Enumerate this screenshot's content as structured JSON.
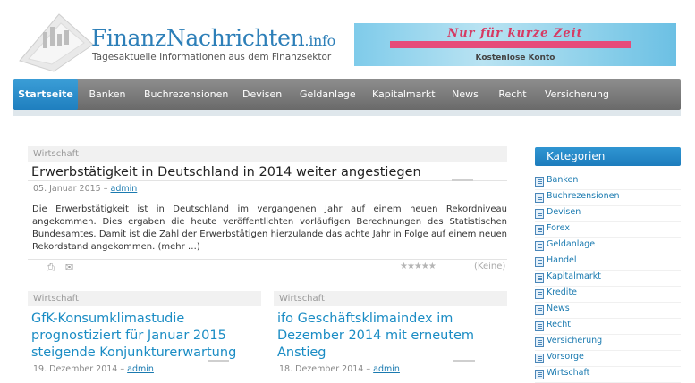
{
  "header": {
    "logo_title_main": "FinanzNachrichten",
    "logo_title_tld": ".info",
    "tagline": "Tagesaktuelle Informationen aus dem Finanzsektor",
    "banner_text": "Nur für kurze Zeit",
    "banner_sub": "Kostenlose Konto"
  },
  "nav": {
    "items": [
      {
        "label": "Startseite",
        "active": true
      },
      {
        "label": "Banken"
      },
      {
        "label": "Buchrezensionen"
      },
      {
        "label": "Devisen"
      },
      {
        "label": "Geldanlage"
      },
      {
        "label": "Kapitalmarkt"
      },
      {
        "label": "News"
      },
      {
        "label": "Recht"
      },
      {
        "label": "Versicherung"
      }
    ]
  },
  "featured": {
    "category": "Wirtschaft",
    "title": "Erwerbstätigkeit in Deutschland in 2014 weiter angestiegen",
    "date": "05. Januar 2015 –",
    "author": "admin",
    "excerpt": "Die Erwerbstätigkeit ist in Deutschland im vergangenen Jahr auf einem neuen Rekordniveau angekommen. Dies ergaben die heute veröffentlichten vorläufigen Berechnungen des Statistischen Bundesamtes. Damit ist die Zahl der Erwerbstätigen hierzulande das achte Jahr in Folge auf einem neuen Rekordstand angekommen. (mehr …)",
    "rating_text": "(Keine)",
    "stars": "★★★★★"
  },
  "posts": [
    {
      "category": "Wirtschaft",
      "title_lines": [
        "GfK-Konsumklimastudie",
        "prognostiziert für Januar 2015",
        "steigende Konjunkturerwartung"
      ],
      "date": "19. Dezember 2014 –",
      "author": "admin"
    },
    {
      "category": "Wirtschaft",
      "title_lines": [
        "ifo Geschäftsklimaindex im",
        "Dezember 2014 mit erneutem",
        "Anstieg"
      ],
      "date": "18. Dezember 2014 –",
      "author": "admin"
    }
  ],
  "sidebar": {
    "heading": "Kategorien",
    "items": [
      "Banken",
      "Buchrezensionen",
      "Devisen",
      "Forex",
      "Geldanlage",
      "Handel",
      "Kapitalmarkt",
      "Kredite",
      "News",
      "Recht",
      "Versicherung",
      "Vorsorge",
      "Wirtschaft"
    ]
  },
  "colors": {
    "accent": "#1f7fbf",
    "nav_bg": "#7a7a7a",
    "link": "#1a8cc4"
  }
}
